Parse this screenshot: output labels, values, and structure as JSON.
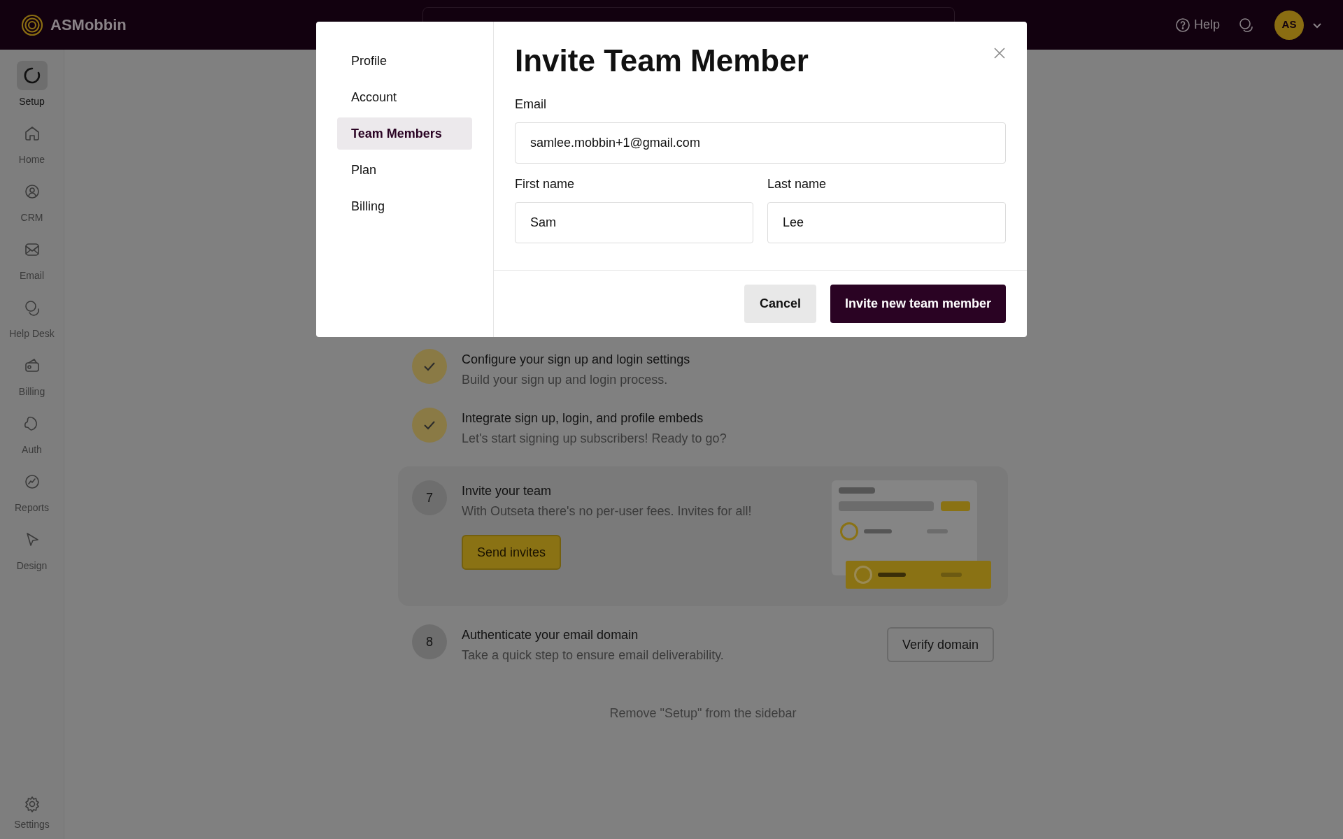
{
  "brand": {
    "name": "ASMobbin"
  },
  "topbar": {
    "help": "Help",
    "avatar": "AS"
  },
  "sidebar": {
    "items": [
      {
        "label": "Setup",
        "kind": "setup",
        "selected": true
      },
      {
        "label": "Home",
        "kind": "home",
        "selected": false
      },
      {
        "label": "CRM",
        "kind": "crm",
        "selected": false
      },
      {
        "label": "Email",
        "kind": "email",
        "selected": false
      },
      {
        "label": "Help Desk",
        "kind": "helpdesk",
        "selected": false
      },
      {
        "label": "Billing",
        "kind": "billing",
        "selected": false
      },
      {
        "label": "Auth",
        "kind": "auth",
        "selected": false
      },
      {
        "label": "Reports",
        "kind": "reports",
        "selected": false
      },
      {
        "label": "Design",
        "kind": "design",
        "selected": false
      }
    ],
    "footer": {
      "label": "Settings"
    }
  },
  "steps": [
    {
      "kind": "done",
      "title": "Configure your sign up and login settings",
      "description": "Build your sign up and login process.",
      "expanded": false
    },
    {
      "kind": "done",
      "title": "Integrate sign up, login, and profile embeds",
      "description": "Let's start signing up subscribers! Ready to go?",
      "expanded": false
    },
    {
      "kind": "number",
      "number": "7",
      "title": "Invite your team",
      "description": "With Outseta there's no per-user fees. Invites for all!",
      "expanded": true,
      "button": "Send invites"
    },
    {
      "kind": "number",
      "number": "8",
      "title": "Authenticate your email domain",
      "description": "Take a quick step to ensure email deliverability.",
      "expanded": false,
      "button": "Verify domain"
    }
  ],
  "remove_link": "Remove \"Setup\" from the sidebar",
  "modal": {
    "nav": [
      {
        "label": "Profile",
        "selected": false
      },
      {
        "label": "Account",
        "selected": false
      },
      {
        "label": "Team Members",
        "selected": true
      },
      {
        "label": "Plan",
        "selected": false
      },
      {
        "label": "Billing",
        "selected": false
      }
    ],
    "title": "Invite Team Member",
    "fields": [
      {
        "label": "Email",
        "value": "samlee.mobbin+1@gmail.com"
      },
      {
        "label": "First name",
        "value": "Sam"
      },
      {
        "label": "Last name",
        "value": "Lee"
      }
    ],
    "cancel": "Cancel",
    "submit": "Invite new team member"
  }
}
